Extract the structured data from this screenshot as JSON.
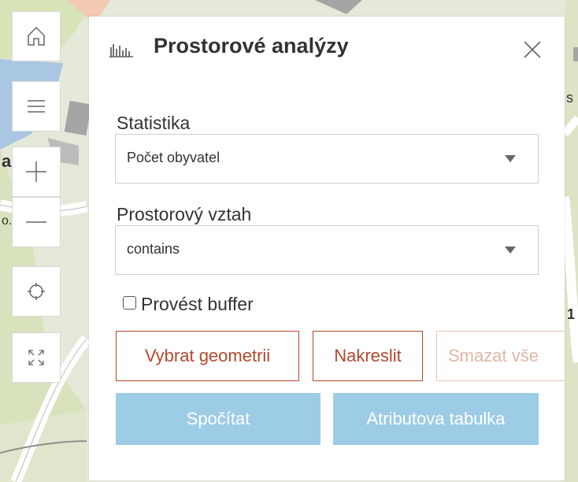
{
  "map": {
    "toolbar": {
      "home": "home-icon",
      "menu": "menu-icon",
      "zoom_in": "plus-icon",
      "zoom_out": "minus-icon",
      "locate": "locate-icon",
      "fullscreen": "fullscreen-icon"
    },
    "edge_labels": {
      "left_a": "a",
      "left_b": "o.",
      "right_s": "s",
      "right_1": "1"
    }
  },
  "panel": {
    "title": "Prostorové analýzy",
    "statistic": {
      "label": "Statistika",
      "value": "Počet obyvatel"
    },
    "spatial_relation": {
      "label": "Prostorový vztah",
      "value": "contains"
    },
    "buffer": {
      "label": "Provést buffer",
      "checked": false
    },
    "buttons": {
      "select_geometry": "Vybrat geometrii",
      "draw": "Nakreslit",
      "clear_all": "Smazat vše",
      "calculate": "Spočítat",
      "attribute_table": "Atributova tabulka"
    },
    "colors": {
      "accent": "#b5472b",
      "primary": "#9ccce6"
    }
  }
}
